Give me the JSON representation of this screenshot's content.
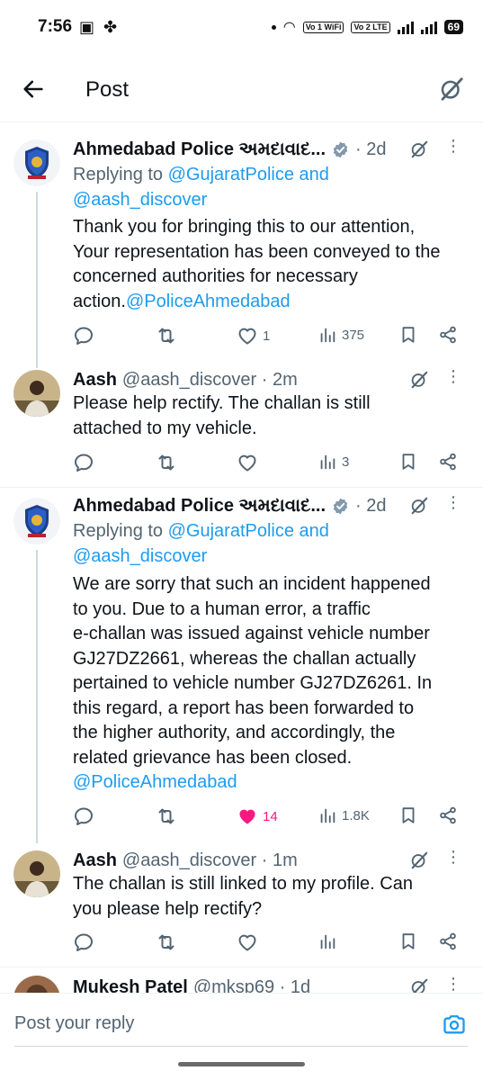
{
  "status_bar": {
    "time": "7:56",
    "vo1": "Vo 1 WiFi",
    "vo2": "Vo 2 LTE",
    "battery": "69"
  },
  "header": {
    "title": "Post"
  },
  "tweets": [
    {
      "name": "Ahmedabad Police અમદાવાદ...",
      "handle": "",
      "time": "· 2d",
      "replying_prefix": "Replying to ",
      "replying_1": "@GujaratPolice and",
      "replying_2": "@aash_discover",
      "text_lines": [
        "Thank you for bringing this to our attention,",
        "Your representation has been conveyed to the",
        "concerned authorities for necessary"
      ],
      "text_last": "action.",
      "text_mention": "@PoliceAhmedabad",
      "replies": "",
      "reposts": "",
      "likes": "1",
      "views": "375"
    },
    {
      "name": "Aash",
      "handle": "@aash_discover · 2m",
      "text_lines": [
        "Please help rectify. The challan is still",
        "attached to my vehicle."
      ],
      "views": "3"
    },
    {
      "name": "Ahmedabad Police અમદાવાદ...",
      "time": "· 2d",
      "replying_prefix": "Replying to ",
      "replying_1": "@GujaratPolice and",
      "replying_2": "@aash_discover",
      "text_lines": [
        "We are sorry that such an incident happened",
        "to you. Due to a human error, a traffic",
        "e-challan was issued against vehicle number",
        "GJ27DZ2661, whereas the challan actually",
        "pertained to vehicle number GJ27DZ6261. In",
        "this regard, a report has been forwarded to",
        "the higher authority, and accordingly, the",
        "related grievance has been closed."
      ],
      "text_mention": "@PoliceAhmedabad",
      "likes": "14",
      "views": "1.8K"
    },
    {
      "name": "Aash",
      "handle": "@aash_discover · 1m",
      "text_lines": [
        "The challan is still linked to my profile. Can",
        "you please help rectify?"
      ]
    },
    {
      "name": "Mukesh Patel",
      "handle": "@mksp69 · 1d"
    }
  ],
  "reply_bar": {
    "placeholder": "Post your reply"
  },
  "colors": {
    "accent": "#1d9bf0",
    "muted": "#536471",
    "like": "#f91880"
  },
  "icons": [
    "back-arrow-icon",
    "grok-icon",
    "verified-badge-icon",
    "reply-icon",
    "repost-icon",
    "like-icon",
    "views-icon",
    "bookmark-icon",
    "share-icon",
    "camera-icon"
  ]
}
